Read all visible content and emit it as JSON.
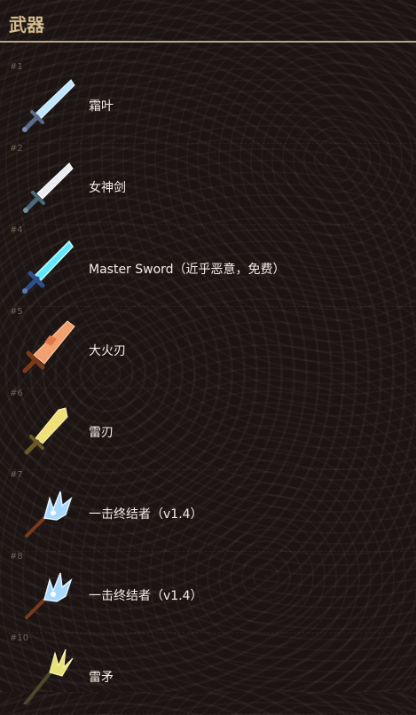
{
  "header": {
    "title": "武器"
  },
  "items": [
    {
      "rank": "#1",
      "name": "霜叶",
      "icon": "frost-sword-icon",
      "colors": {
        "blade": "#bfe6ff",
        "hilt": "#5a6b8a"
      }
    },
    {
      "rank": "#2",
      "name": "女神剑",
      "icon": "goddess-sword-icon",
      "colors": {
        "blade": "#e9edf2",
        "hilt": "#4a6b7a"
      }
    },
    {
      "rank": "#4",
      "name": "Master Sword（近乎恶意，免费）",
      "icon": "master-sword-icon",
      "colors": {
        "blade": "#5fe7ff",
        "hilt": "#2f4f8a"
      }
    },
    {
      "rank": "#5",
      "name": "大火刃",
      "icon": "great-flameblade-icon",
      "colors": {
        "blade": "#f2a070",
        "hilt": "#7a3a1a"
      }
    },
    {
      "rank": "#6",
      "name": "雷刃",
      "icon": "thunderblade-icon",
      "colors": {
        "blade": "#f0e07a",
        "hilt": "#6a5a2a"
      }
    },
    {
      "rank": "#7",
      "name": "一击终结者（v1.4）",
      "icon": "one-hit-obliterator-icon",
      "colors": {
        "blade": "#a8d8ff",
        "hilt": "#7a3a1a"
      }
    },
    {
      "rank": "#8",
      "name": "一击终结者（v1.4）",
      "icon": "one-hit-obliterator-icon",
      "colors": {
        "blade": "#a8d8ff",
        "hilt": "#7a3a1a"
      }
    },
    {
      "rank": "#10",
      "name": "雷矛",
      "icon": "thunderspear-icon",
      "colors": {
        "blade": "#e6e27a",
        "hilt": "#4a4a2a"
      }
    }
  ]
}
